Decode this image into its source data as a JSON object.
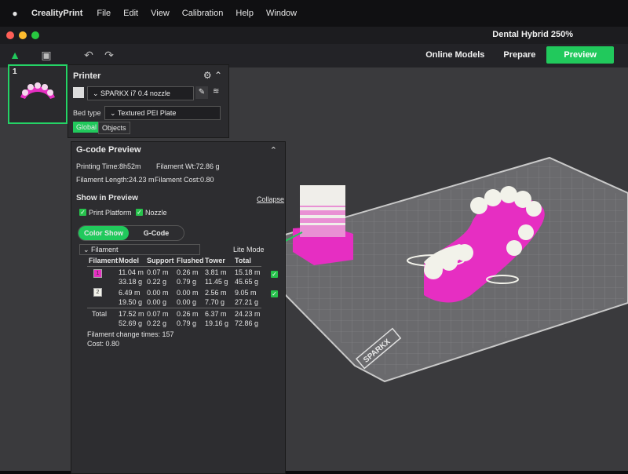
{
  "mac_menu": {
    "app": "CrealityPrint",
    "items": [
      "File",
      "Edit",
      "View",
      "Calibration",
      "Help",
      "Window"
    ]
  },
  "window": {
    "title": "Dental Hybrid 250%"
  },
  "tabs": {
    "online": "Online Models",
    "prepare": "Prepare",
    "preview": "Preview"
  },
  "plate_thumb": {
    "number": "1"
  },
  "printer": {
    "title": "Printer",
    "name": "SPARKX i7 0.4 nozzle",
    "bed_type_label": "Bed type",
    "bed_type": "Textured PEI Plate",
    "global": "Global",
    "objects": "Objects"
  },
  "gcode": {
    "title": "G-code Preview",
    "printing_time": "Printing Time:8h52m",
    "filament_wt": "Filament Wt:72.86 g",
    "filament_length": "Filament Length:24.23 m",
    "filament_cost": "Filament Cost:0.80",
    "show_in_preview": "Show in Preview",
    "collapse": "Collapse",
    "print_platform": "Print Platform",
    "nozzle": "Nozzle",
    "color_show": "Color Show",
    "gcode_mode": "G-Code",
    "lite_mode": "Lite Mode",
    "filament_select": "Filament",
    "headers": [
      "Filament",
      "Model",
      "Support",
      "Flushed",
      "Tower",
      "Total"
    ],
    "rows": [
      {
        "id": "1",
        "color": "#e62ec2",
        "m": [
          "11.04 m",
          "0.07 m",
          "0.26 m",
          "3.81 m",
          "15.18 m"
        ],
        "g": [
          "33.18 g",
          "0.22 g",
          "0.79 g",
          "11.45 g",
          "45.65 g"
        ]
      },
      {
        "id": "2",
        "color": "#f2f2ea",
        "m": [
          "6.49 m",
          "0.00 m",
          "0.00 m",
          "2.56 m",
          "9.05 m"
        ],
        "g": [
          "19.50 g",
          "0.00 g",
          "0.00 g",
          "7.70 g",
          "27.21 g"
        ]
      }
    ],
    "total_label": "Total",
    "total_m": [
      "17.52 m",
      "0.07 m",
      "0.26 m",
      "6.37 m",
      "24.23 m"
    ],
    "total_g": [
      "52.69 g",
      "0.22 g",
      "0.79 g",
      "19.16 g",
      "72.86 g"
    ],
    "change_times": "Filament change times:  157",
    "cost": "Cost:  0.80"
  },
  "plate_brand": "SPARKX",
  "colors": {
    "accent": "#21c95c",
    "magenta": "#e62ec2",
    "white": "#f2f2ea"
  }
}
